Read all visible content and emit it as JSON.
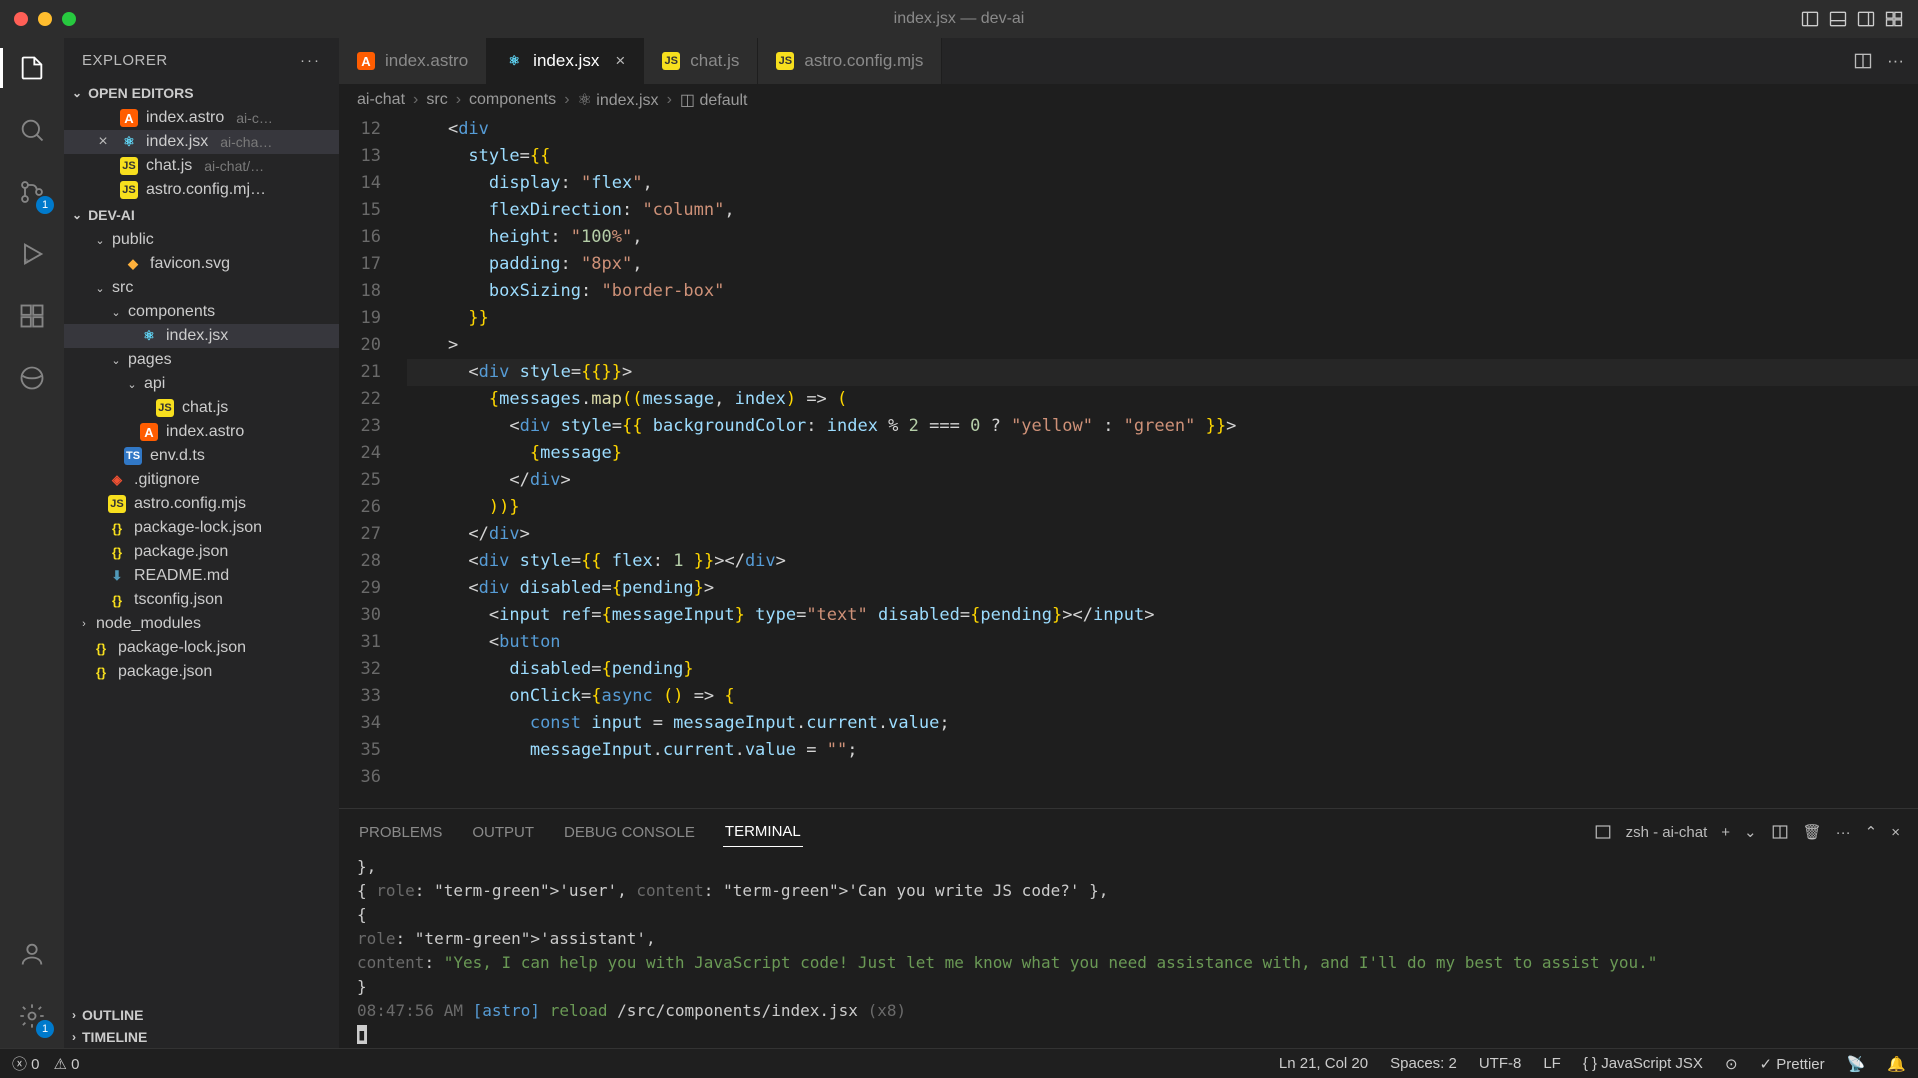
{
  "window": {
    "title": "index.jsx — dev-ai"
  },
  "explorer": {
    "title": "EXPLORER",
    "openEditors": {
      "title": "OPEN EDITORS",
      "items": [
        {
          "name": "index.astro",
          "meta": "ai-c…",
          "icon": "astro"
        },
        {
          "name": "index.jsx",
          "meta": "ai-cha…",
          "icon": "jsx",
          "closable": true
        },
        {
          "name": "chat.js",
          "meta": "ai-chat/…",
          "icon": "js"
        },
        {
          "name": "astro.config.mj…",
          "meta": "",
          "icon": "js"
        }
      ]
    },
    "project": {
      "title": "DEV-AI",
      "tree": [
        {
          "kind": "folder",
          "name": "public",
          "depth": 1,
          "open": true
        },
        {
          "kind": "file",
          "name": "favicon.svg",
          "depth": 2,
          "icon": "svg"
        },
        {
          "kind": "folder",
          "name": "src",
          "depth": 1,
          "open": true
        },
        {
          "kind": "folder",
          "name": "components",
          "depth": 2,
          "open": true
        },
        {
          "kind": "file",
          "name": "index.jsx",
          "depth": 3,
          "icon": "jsx",
          "selected": true
        },
        {
          "kind": "folder",
          "name": "pages",
          "depth": 2,
          "open": true
        },
        {
          "kind": "folder",
          "name": "api",
          "depth": 3,
          "open": true
        },
        {
          "kind": "file",
          "name": "chat.js",
          "depth": 4,
          "icon": "js"
        },
        {
          "kind": "file",
          "name": "index.astro",
          "depth": 3,
          "icon": "astro"
        },
        {
          "kind": "file",
          "name": "env.d.ts",
          "depth": 2,
          "icon": "ts"
        },
        {
          "kind": "file",
          "name": ".gitignore",
          "depth": 1,
          "icon": "git"
        },
        {
          "kind": "file",
          "name": "astro.config.mjs",
          "depth": 1,
          "icon": "js"
        },
        {
          "kind": "file",
          "name": "package-lock.json",
          "depth": 1,
          "icon": "json"
        },
        {
          "kind": "file",
          "name": "package.json",
          "depth": 1,
          "icon": "json"
        },
        {
          "kind": "file",
          "name": "README.md",
          "depth": 1,
          "icon": "md"
        },
        {
          "kind": "file",
          "name": "tsconfig.json",
          "depth": 1,
          "icon": "json"
        },
        {
          "kind": "folder",
          "name": "node_modules",
          "depth": 0,
          "open": false
        },
        {
          "kind": "file",
          "name": "package-lock.json",
          "depth": 0,
          "icon": "json"
        },
        {
          "kind": "file",
          "name": "package.json",
          "depth": 0,
          "icon": "json"
        }
      ]
    },
    "outline": "OUTLINE",
    "timeline": "TIMELINE"
  },
  "tabs": [
    {
      "name": "index.astro",
      "icon": "astro"
    },
    {
      "name": "index.jsx",
      "icon": "jsx",
      "active": true,
      "closable": true
    },
    {
      "name": "chat.js",
      "icon": "js"
    },
    {
      "name": "astro.config.mjs",
      "icon": "js"
    }
  ],
  "breadcrumb": [
    "ai-chat",
    "src",
    "components",
    "index.jsx",
    "default"
  ],
  "code": {
    "startLine": 12,
    "lines": [
      "    <div",
      "      style={{",
      "        display: \"flex\",",
      "        flexDirection: \"column\",",
      "        height: \"100%\",",
      "        padding: \"8px\",",
      "        boxSizing: \"border-box\"",
      "      }}",
      "    >",
      "      <div style={{}}>",
      "        {messages.map((message, index) => (",
      "          <div style={{ backgroundColor: index % 2 === 0 ? \"yellow\" : \"green\" }}>",
      "            {message}",
      "          </div>",
      "        ))}",
      "      </div>",
      "      <div style={{ flex: 1 }}></div>",
      "      <div disabled={pending}>",
      "        <input ref={messageInput} type=\"text\" disabled={pending}></input>",
      "        <button",
      "          disabled={pending}",
      "          onClick={async () => {",
      "            const input = messageInput.current.value;",
      "            messageInput.current.value = \"\";",
      ""
    ],
    "highlightLine": 21
  },
  "panel": {
    "tabs": [
      "PROBLEMS",
      "OUTPUT",
      "DEBUG CONSOLE",
      "TERMINAL"
    ],
    "active": 3,
    "shell": "zsh - ai-chat",
    "terminal": [
      "  },",
      "  { role: 'user', content: 'Can you write JS code?' },",
      "  {",
      "    role: 'assistant',",
      "    content: \"Yes, I can help you with JavaScript code! Just let me know what you need assistance with, and I'll do my best to assist you.\"",
      "  }",
      "08:47:56 AM [astro] reload /src/components/index.jsx (x8)"
    ]
  },
  "status": {
    "errors": "0",
    "warnings": "0",
    "position": "Ln 21, Col 20",
    "spaces": "Spaces: 2",
    "encoding": "UTF-8",
    "eol": "LF",
    "language": "JavaScript JSX",
    "prettier": "Prettier"
  },
  "scm_badge": "1"
}
